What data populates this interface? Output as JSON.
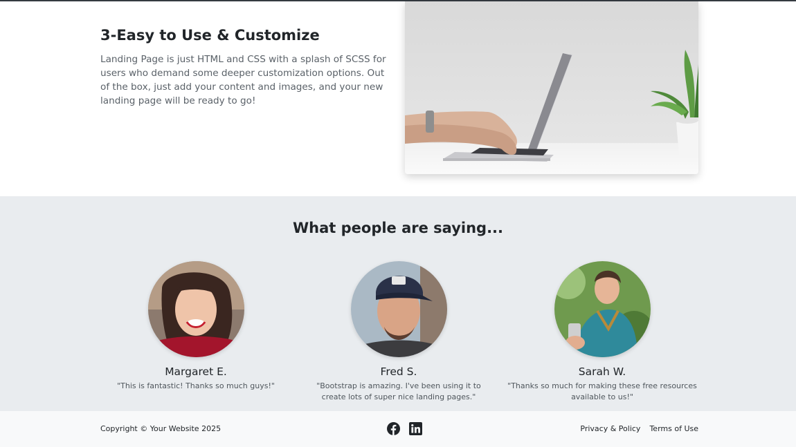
{
  "showcase": {
    "title": "3-Easy to Use & Customize",
    "description": "Landing Page is just HTML and CSS with a splash of SCSS for users who demand some deeper customization options. Out of the box, just add your content and images, and your new landing page will be ready to go!"
  },
  "testimonials": {
    "heading": "What people are saying...",
    "items": [
      {
        "name": "Margaret E.",
        "quote": "\"This is fantastic! Thanks so much guys!\""
      },
      {
        "name": "Fred S.",
        "quote": "\"Bootstrap is amazing. I've been using it to create lots of super nice landing pages.\""
      },
      {
        "name": "Sarah W.",
        "quote": "\"Thanks so much for making these free resources available to us!\""
      }
    ]
  },
  "footer": {
    "copyright": "Copyright © Your Website 2025",
    "social_icons": [
      "facebook-icon",
      "linkedin-icon"
    ],
    "links": [
      "Privacy & Policy",
      "Terms of Use"
    ]
  },
  "colors": {
    "testimonials_bg": "#e9ecef",
    "footer_bg": "#f8f9fa",
    "text": "#212529"
  }
}
